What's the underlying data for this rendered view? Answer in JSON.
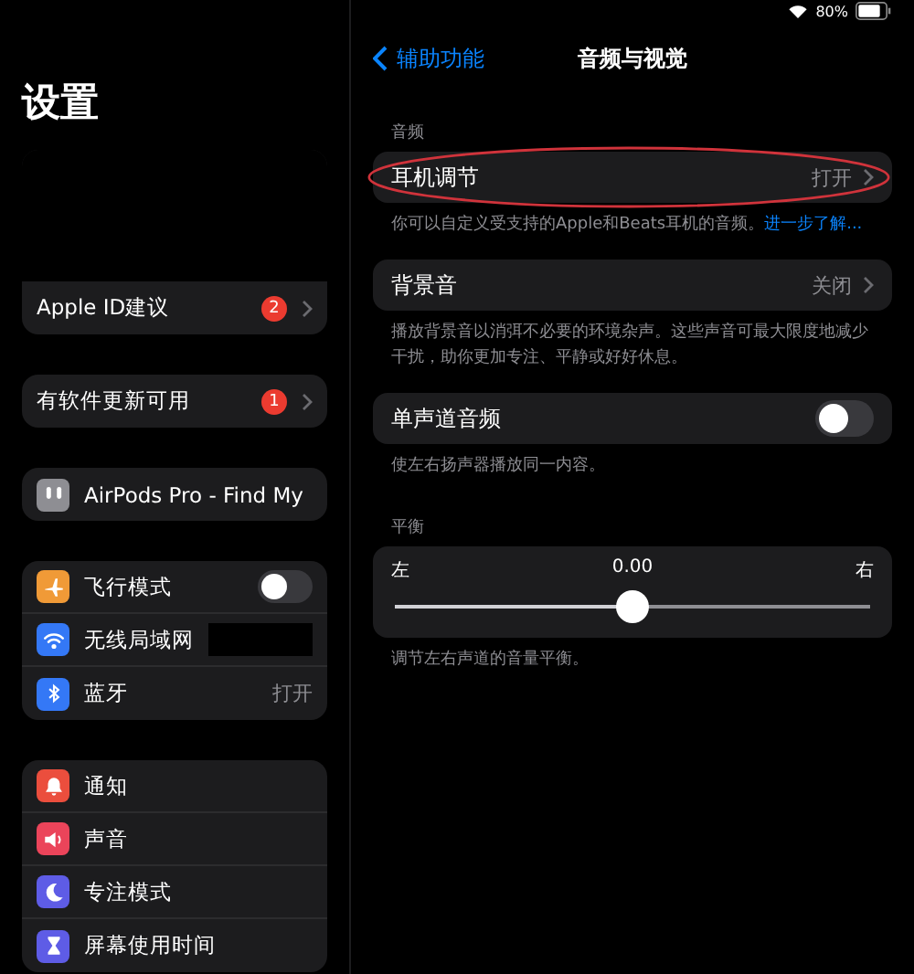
{
  "status_bar": {
    "battery": "80%"
  },
  "sidebar": {
    "title": "设置",
    "groups": [
      {
        "profile": true,
        "items": [
          {
            "kind": "badge",
            "label": "Apple ID建议",
            "badge": "2"
          }
        ]
      },
      {
        "items": [
          {
            "kind": "badge",
            "label": "有软件更新可用",
            "badge": "1"
          }
        ]
      },
      {
        "items": [
          {
            "kind": "plain",
            "label": "AirPods Pro - Find My",
            "color": "#8e8e93"
          }
        ]
      },
      {
        "items": [
          {
            "kind": "toggle",
            "label": "飞行模式",
            "on": false,
            "color": "#f09a37"
          },
          {
            "kind": "redacted",
            "label": "无线局域网",
            "color": "#3478f6"
          },
          {
            "kind": "value",
            "label": "蓝牙",
            "value": "打开",
            "color": "#3478f6"
          }
        ]
      },
      {
        "items": [
          {
            "kind": "plain",
            "label": "通知",
            "color": "#eb4e3d"
          },
          {
            "kind": "plain",
            "label": "声音",
            "color": "#eb445a"
          },
          {
            "kind": "plain",
            "label": "专注模式",
            "color": "#5e5ce6"
          },
          {
            "kind": "plain",
            "label": "屏幕使用时间",
            "color": "#5e5ce6"
          }
        ]
      }
    ]
  },
  "nav": {
    "back": "辅助功能",
    "title": "音频与视觉"
  },
  "sections": [
    {
      "header": "音频",
      "row": {
        "kind": "value",
        "label": "耳机调节",
        "value": "打开",
        "circled": true
      },
      "footer": "你可以自定义受支持的Apple和Beats耳机的音频。",
      "link": "进一步了解..."
    },
    {
      "row": {
        "kind": "value",
        "label": "背景音",
        "value": "关闭",
        "circled": false
      },
      "footer": "播放背景音以消弭不必要的环境杂声。这些声音可最大限度地减少干扰，助你更加专注、平静或好好休息。"
    },
    {
      "row": {
        "kind": "toggle",
        "label": "单声道音频",
        "on": false
      },
      "footer": "使左右扬声器播放同一内容。"
    },
    {
      "header": "平衡",
      "row": {
        "kind": "slider",
        "left": "左",
        "reading": "0.00",
        "right": "右",
        "level": 0.5
      },
      "footer": "调节左右声道的音量平衡。"
    }
  ]
}
